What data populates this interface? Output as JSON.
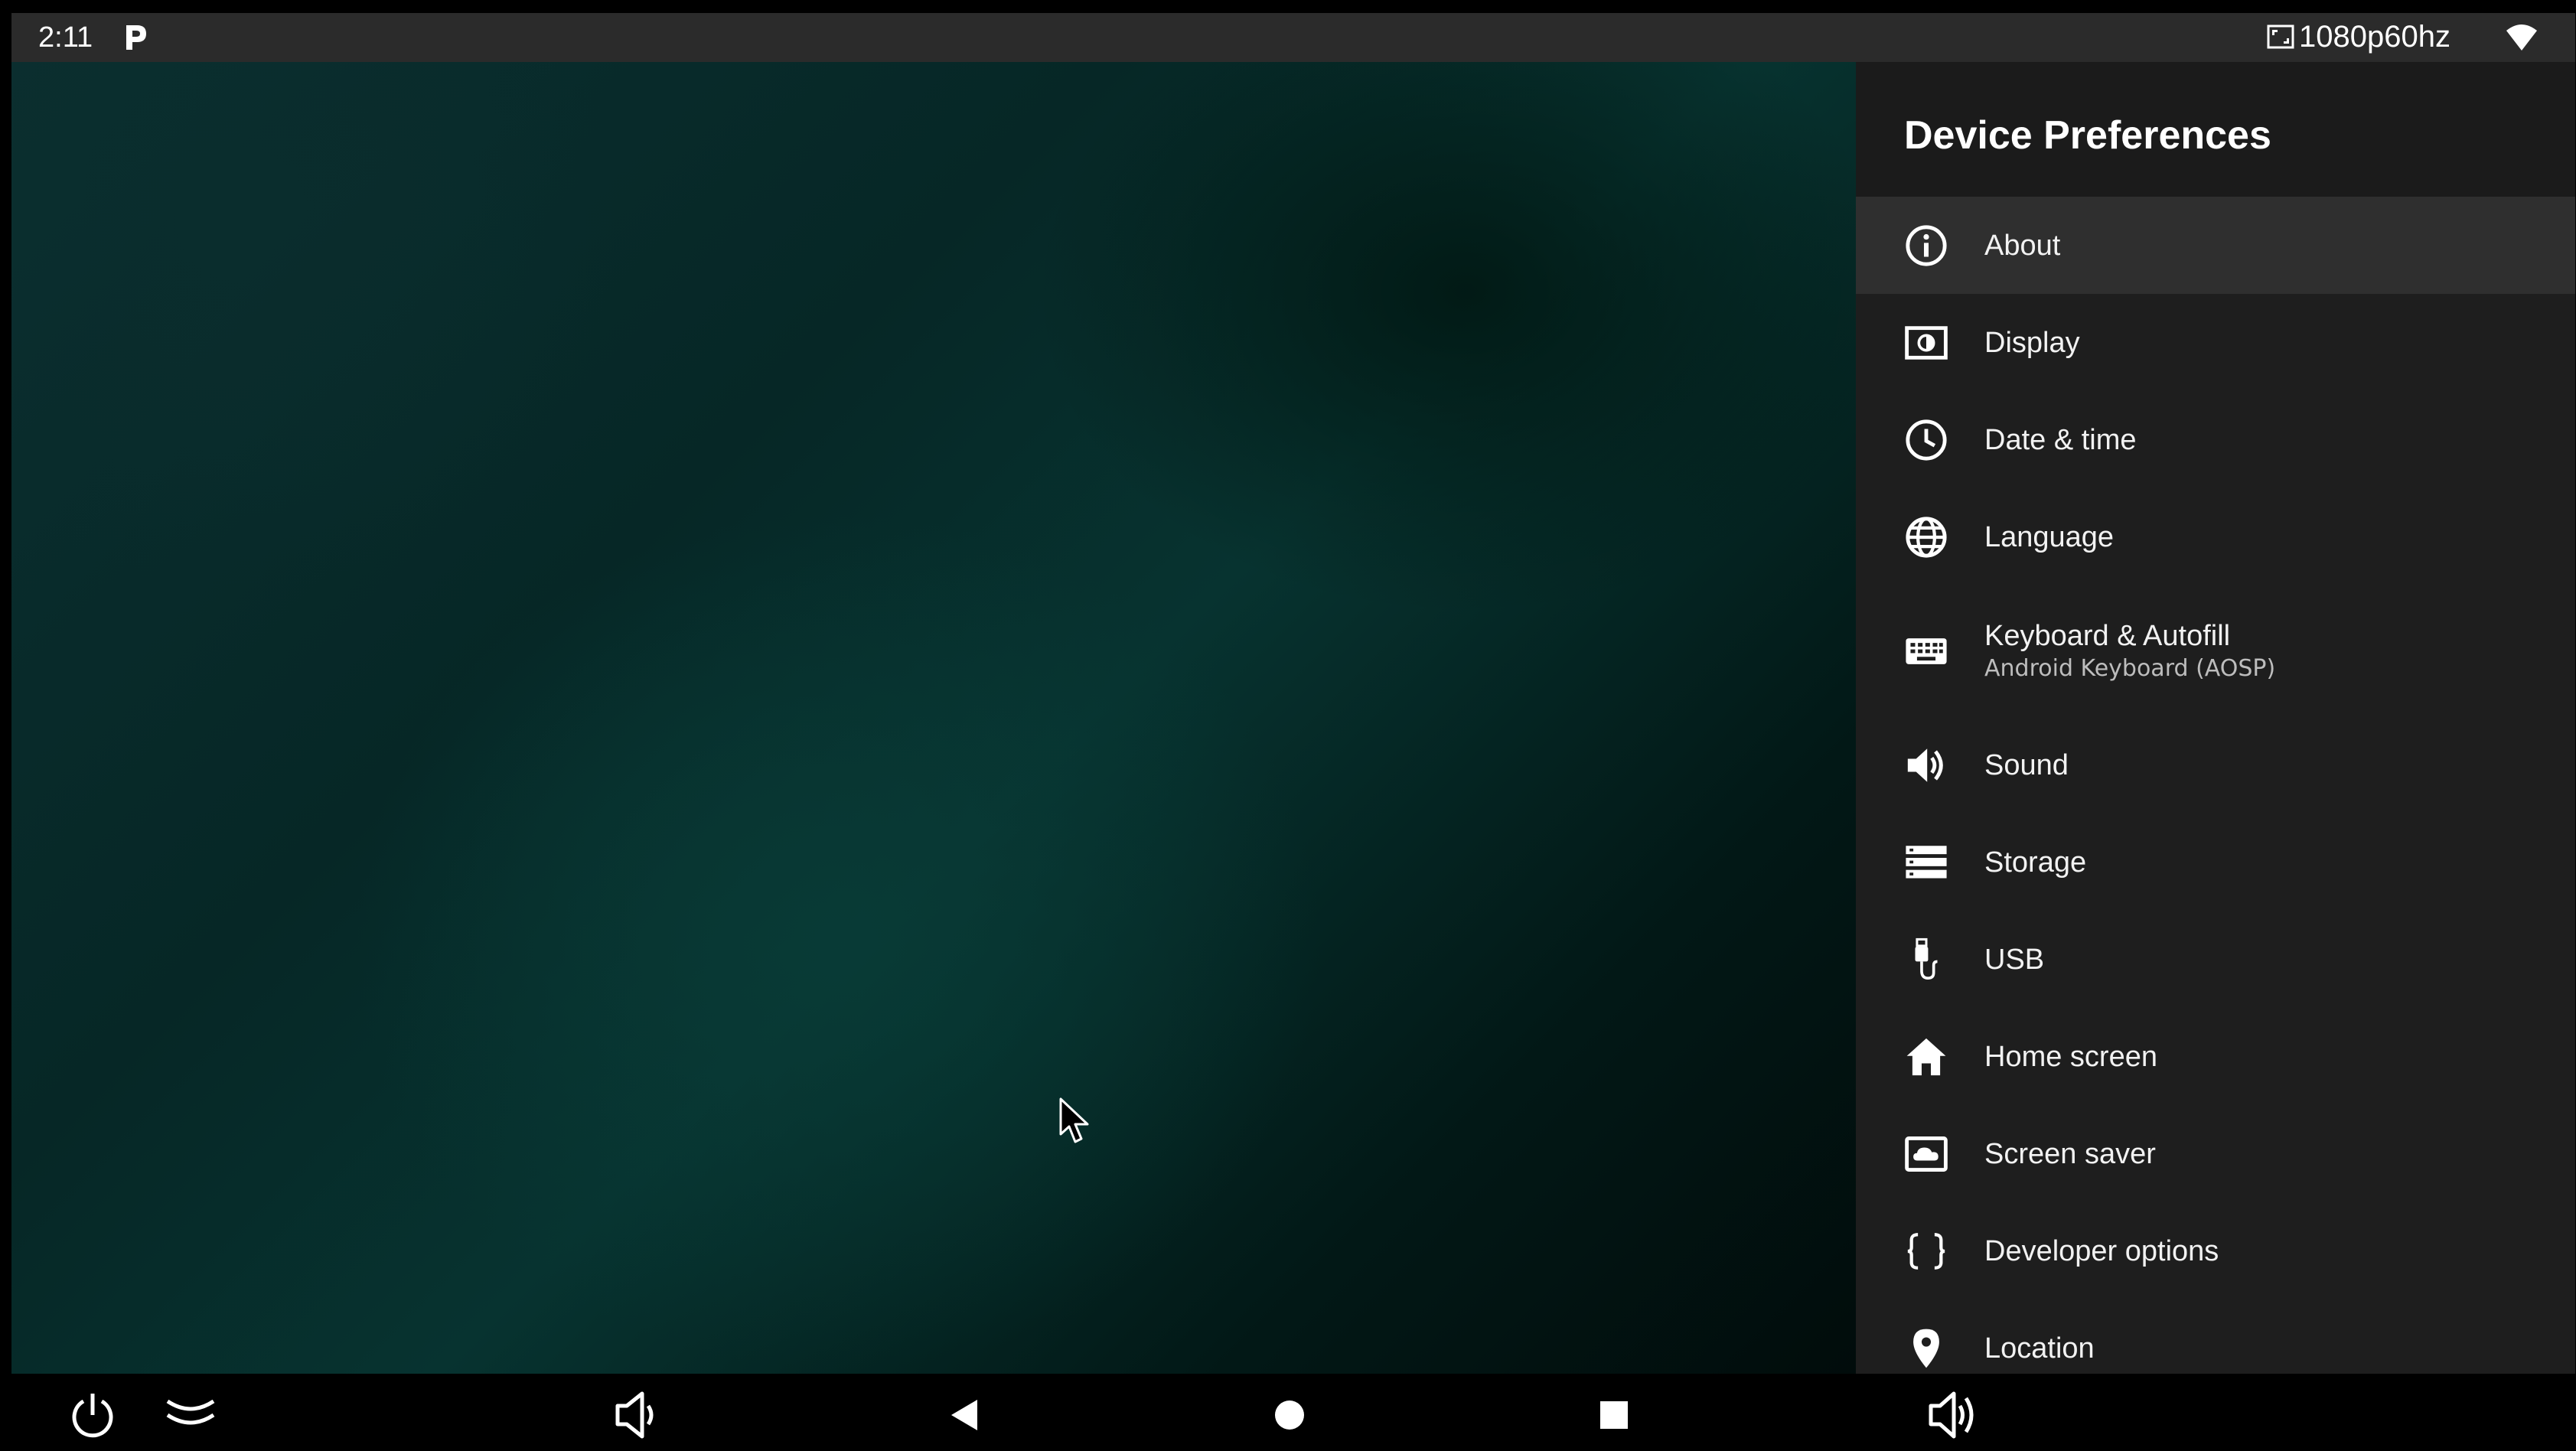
{
  "status_bar": {
    "time": "2:11",
    "notification_icon": "p-icon",
    "resolution": "1080p60hz",
    "wifi_icon": "wifi-icon"
  },
  "panel": {
    "title": "Device Preferences",
    "items": [
      {
        "label": "About",
        "icon": "info-icon",
        "focused": true
      },
      {
        "label": "Display",
        "icon": "display-icon"
      },
      {
        "label": "Date & time",
        "icon": "clock-icon"
      },
      {
        "label": "Language",
        "icon": "globe-icon"
      },
      {
        "label": "Keyboard & Autofill",
        "sublabel": "Android Keyboard (AOSP)",
        "icon": "keyboard-icon"
      },
      {
        "label": "Sound",
        "icon": "speaker-icon"
      },
      {
        "label": "Storage",
        "icon": "storage-icon"
      },
      {
        "label": "USB",
        "icon": "usb-icon"
      },
      {
        "label": "Home screen",
        "icon": "home-icon"
      },
      {
        "label": "Screen saver",
        "icon": "screen-saver-icon"
      },
      {
        "label": "Developer options",
        "icon": "braces-icon"
      },
      {
        "label": "Location",
        "icon": "location-icon"
      }
    ]
  },
  "nav_bar": {
    "buttons": [
      "power-icon",
      "collapse-icon",
      "volume-down-icon",
      "back-icon",
      "home-icon",
      "recents-icon",
      "volume-up-icon"
    ]
  },
  "colors": {
    "status_bar_bg": "#2b2b2b",
    "panel_bg": "#1e1e1e",
    "focused_item_bg": "#2f2f2f",
    "nav_bar_bg": "#000000"
  }
}
